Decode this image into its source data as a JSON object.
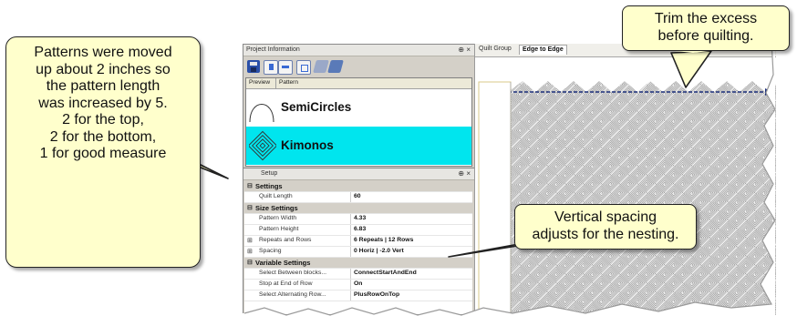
{
  "project_panel": {
    "title": "Project Information",
    "pin_glyph": "⊕ ×",
    "columns": [
      "Preview",
      "Pattern"
    ],
    "patterns": [
      {
        "name": "SemiCircles",
        "selected": false
      },
      {
        "name": "Kimonos",
        "selected": true
      }
    ],
    "selected_color": "#00e5ee"
  },
  "setup_panel": {
    "title": "Setup",
    "pin_glyph": "⊕ ×",
    "rows": [
      {
        "type": "cat",
        "label": "Settings",
        "value": ""
      },
      {
        "type": "prop",
        "label": "Quilt Length",
        "value": "60"
      },
      {
        "type": "cat",
        "label": "Size Settings",
        "value": ""
      },
      {
        "type": "prop",
        "label": "Pattern Width",
        "value": "4.33"
      },
      {
        "type": "prop",
        "label": "Pattern Height",
        "value": "6.83"
      },
      {
        "type": "prop",
        "label": "Repeats and Rows",
        "value": "6 Repeats | 12 Rows"
      },
      {
        "type": "prop",
        "label": "Spacing",
        "value": "0 Horiz | -2.0 Vert"
      },
      {
        "type": "cat",
        "label": "Variable Settings",
        "value": ""
      },
      {
        "type": "prop",
        "label": "Select Between blocks...",
        "value": "ConnectStartAndEnd"
      },
      {
        "type": "prop",
        "label": "Stop at End of Row",
        "value": "On"
      },
      {
        "type": "prop",
        "label": "Select Alternating Row...",
        "value": "PlusRowOnTop"
      }
    ]
  },
  "quilt_panel": {
    "tabs": [
      {
        "label": "Quilt Group",
        "active": false
      },
      {
        "label": "Edge to Edge",
        "active": true
      }
    ]
  },
  "callouts": {
    "left": [
      "Patterns were moved",
      "up about 2 inches so",
      "the pattern length",
      "was increased by 5.",
      "2 for the top,",
      "2 for the bottom,",
      "1 for good measure"
    ],
    "top_right": [
      "Trim the excess",
      "before quilting."
    ],
    "bottom_right": [
      "Vertical spacing",
      "adjusts for the nesting."
    ]
  },
  "colors": {
    "callout_fill": "#ffffcc",
    "pattern_line": "#1b2e7a",
    "panel_bg": "#d4d0c8"
  }
}
